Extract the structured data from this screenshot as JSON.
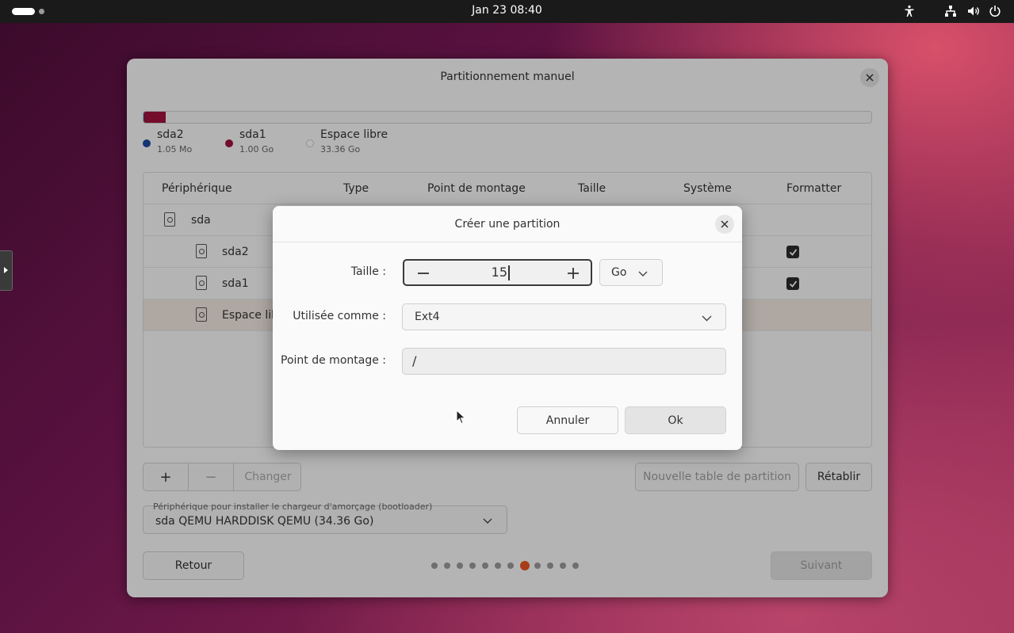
{
  "topbar": {
    "clock": "Jan 23  08:40",
    "icons": [
      "accessibility-icon",
      "network-icon",
      "volume-icon",
      "power-icon"
    ]
  },
  "window": {
    "title": "Partitionnement manuel",
    "usage": [
      {
        "name": "sda2",
        "fraction": 3e-05,
        "color": "#1c4aa0"
      },
      {
        "name": "sda1",
        "fraction": 0.029,
        "color": "#a0123c"
      }
    ],
    "legend": [
      {
        "name": "sda2",
        "size": "1.05 Mo",
        "color": "#1c4aa0"
      },
      {
        "name": "sda1",
        "size": "1.00 Go",
        "color": "#a0123c"
      },
      {
        "name": "Espace libre",
        "size": "33.36 Go",
        "color": "#ffffff"
      }
    ],
    "table": {
      "columns": [
        "Périphérique",
        "Type",
        "Point de montage",
        "Taille",
        "Système",
        "Formatter"
      ],
      "rows": [
        {
          "device": "sda",
          "formatted": false
        },
        {
          "device": "sda2",
          "formatted": true
        },
        {
          "device": "sda1",
          "formatted": true
        },
        {
          "device": "Espace libre",
          "formatted": false
        }
      ]
    },
    "actions": {
      "add": "+",
      "remove": "−",
      "change": "Changer",
      "new_table": "Nouvelle table de partition",
      "revert": "Rétablir"
    },
    "bootloader": {
      "label": "Périphérique pour installer le chargeur d'amorçage (bootloader)",
      "value": "sda QEMU HARDDISK QEMU (34.36 Go)"
    },
    "nav": {
      "back": "Retour",
      "next": "Suivant",
      "pages_total": 12,
      "page_current": 8
    }
  },
  "dialog": {
    "title": "Créer une partition",
    "size_label": "Taille :",
    "size_value": "15",
    "size_unit": "Go",
    "use_label": "Utilisée comme :",
    "use_value": "Ext4",
    "mount_label": "Point de montage :",
    "mount_value": "/",
    "cancel": "Annuler",
    "ok": "Ok"
  }
}
